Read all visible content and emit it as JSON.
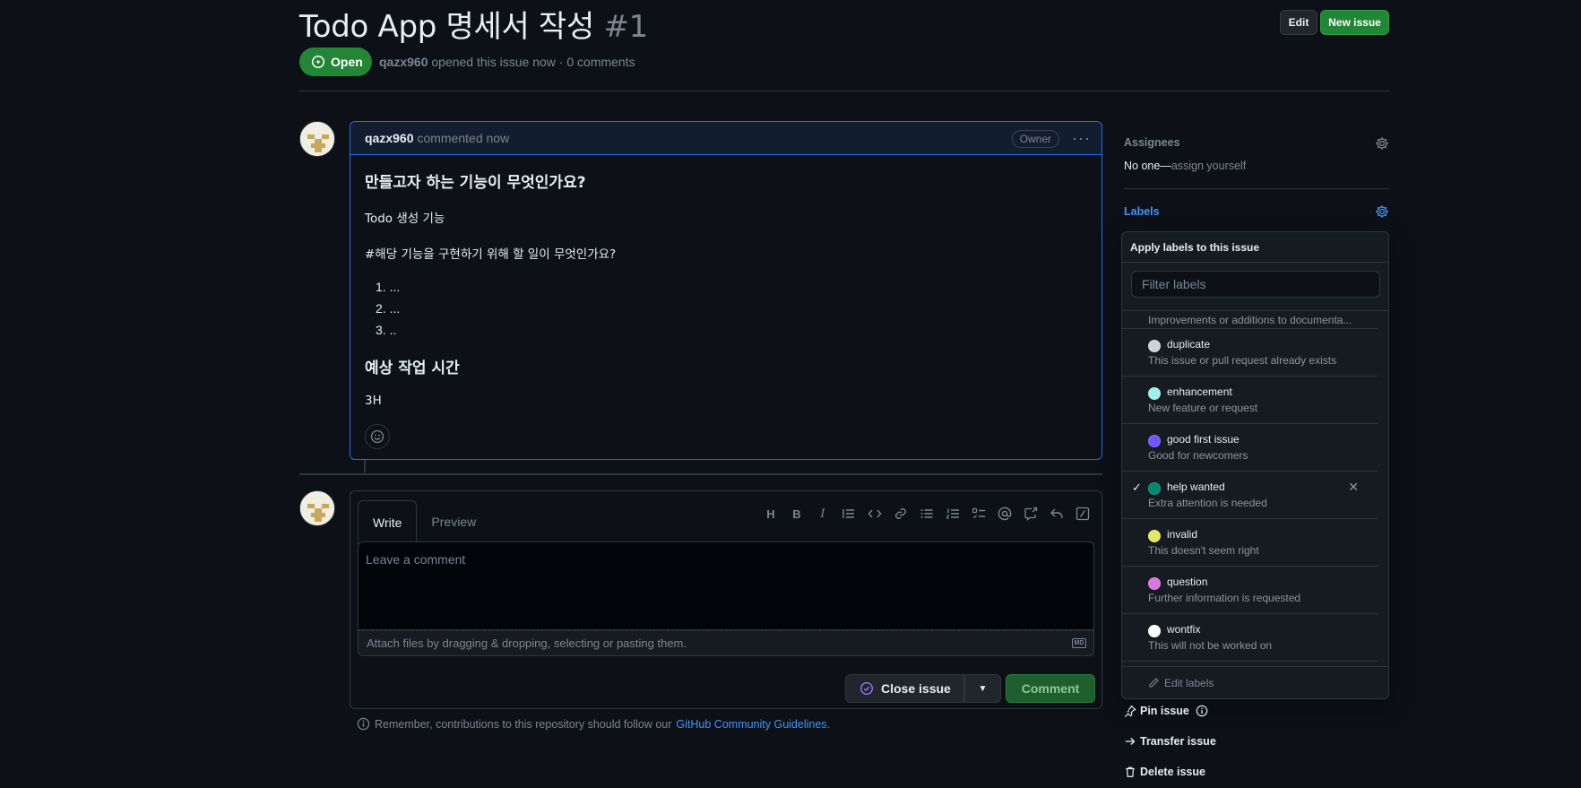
{
  "header": {
    "title": "Todo App 명세서 작성",
    "number": "#1",
    "edit_label": "Edit",
    "new_issue_label": "New issue",
    "status": "Open",
    "author": "qazx960",
    "meta_text": "opened this issue now · 0 comments"
  },
  "comment": {
    "author": "qazx960",
    "time": "commented now",
    "role_badge": "Owner",
    "heading1": "만들고자 하는 기능이 무엇인가요?",
    "para1": "Todo 생성 기능",
    "para2": "#해당 기능을 구현하기 위해 할 일이 무엇인가요?",
    "list": [
      "1. ...",
      "2. ...",
      "3. .."
    ],
    "heading2": "예상 작업 시간",
    "para3": "3H"
  },
  "composer": {
    "tab_write": "Write",
    "tab_preview": "Preview",
    "tools": [
      "heading-icon",
      "bold-icon",
      "italic-icon",
      "quote-icon",
      "code-icon",
      "link-icon",
      "unordered-list-icon",
      "ordered-list-icon",
      "task-list-icon",
      "mention-icon",
      "cross-reference-icon",
      "saved-reply-icon",
      "slash-command-icon"
    ],
    "placeholder": "Leave a comment",
    "attach_text": "Attach files by dragging & dropping, selecting or pasting them.",
    "markdown_badge": "MD",
    "close_issue_label": "Close issue",
    "comment_label": "Comment"
  },
  "note": {
    "text": "Remember, contributions to this repository should follow our",
    "link": "GitHub Community Guidelines",
    "end": "."
  },
  "sidebar": {
    "assignees_title": "Assignees",
    "assignees_none": "No one—",
    "assign_yourself": "assign yourself",
    "labels_title": "Labels",
    "pin_issue": "Pin issue",
    "transfer_issue": "Transfer issue",
    "delete_issue": "Delete issue"
  },
  "label_menu": {
    "title": "Apply labels to this issue",
    "filter_placeholder": "Filter labels",
    "cut_item_desc": "Improvements or additions to documenta...",
    "items": [
      {
        "name": "duplicate",
        "desc": "This issue or pull request already exists",
        "color": "#cfd3d7",
        "checked": false
      },
      {
        "name": "enhancement",
        "desc": "New feature or request",
        "color": "#a2eeef",
        "checked": false
      },
      {
        "name": "good first issue",
        "desc": "Good for newcomers",
        "color": "#7057ff",
        "checked": false
      },
      {
        "name": "help wanted",
        "desc": "Extra attention is needed",
        "color": "#008672",
        "checked": true
      },
      {
        "name": "invalid",
        "desc": "This doesn't seem right",
        "color": "#e4e669",
        "checked": false
      },
      {
        "name": "question",
        "desc": "Further information is requested",
        "color": "#d876e3",
        "checked": false
      },
      {
        "name": "wontfix",
        "desc": "This will not be worked on",
        "color": "#ffffff",
        "checked": false
      }
    ],
    "edit_labels": "Edit labels"
  },
  "colors": {
    "background": "#0d1117",
    "accent_blue": "#4493f8",
    "open_green": "#238636"
  }
}
